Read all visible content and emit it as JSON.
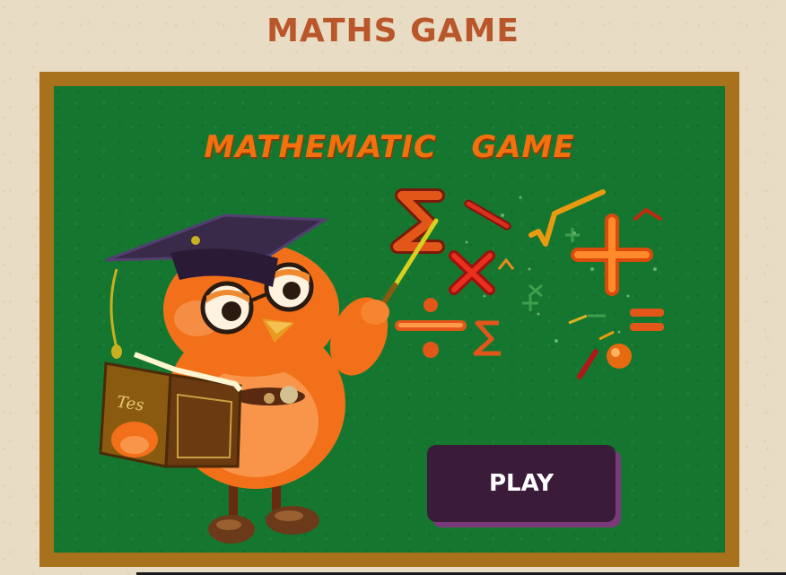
{
  "header": {
    "title": "MATHS GAME"
  },
  "board": {
    "title": "MATHEMATIC   GAME"
  },
  "book": {
    "cover_text": "Tes"
  },
  "actions": {
    "play_label": "PLAY"
  },
  "colors": {
    "page_bg": "#e8dcc4",
    "title": "#b9562a",
    "frame": "#a8721c",
    "chalkboard": "#15772f",
    "board_title": "#f2700e",
    "play_button": "#3a1b3a",
    "play_shadow": "#7a3a7a"
  },
  "icons": [
    "owl-teacher-illustration",
    "graduation-cap-icon",
    "book-icon",
    "pointer-stick-icon",
    "sigma-icon",
    "minus-icon",
    "sqrt-icon",
    "plus-icon",
    "times-icon",
    "divide-icon",
    "equals-icon"
  ]
}
